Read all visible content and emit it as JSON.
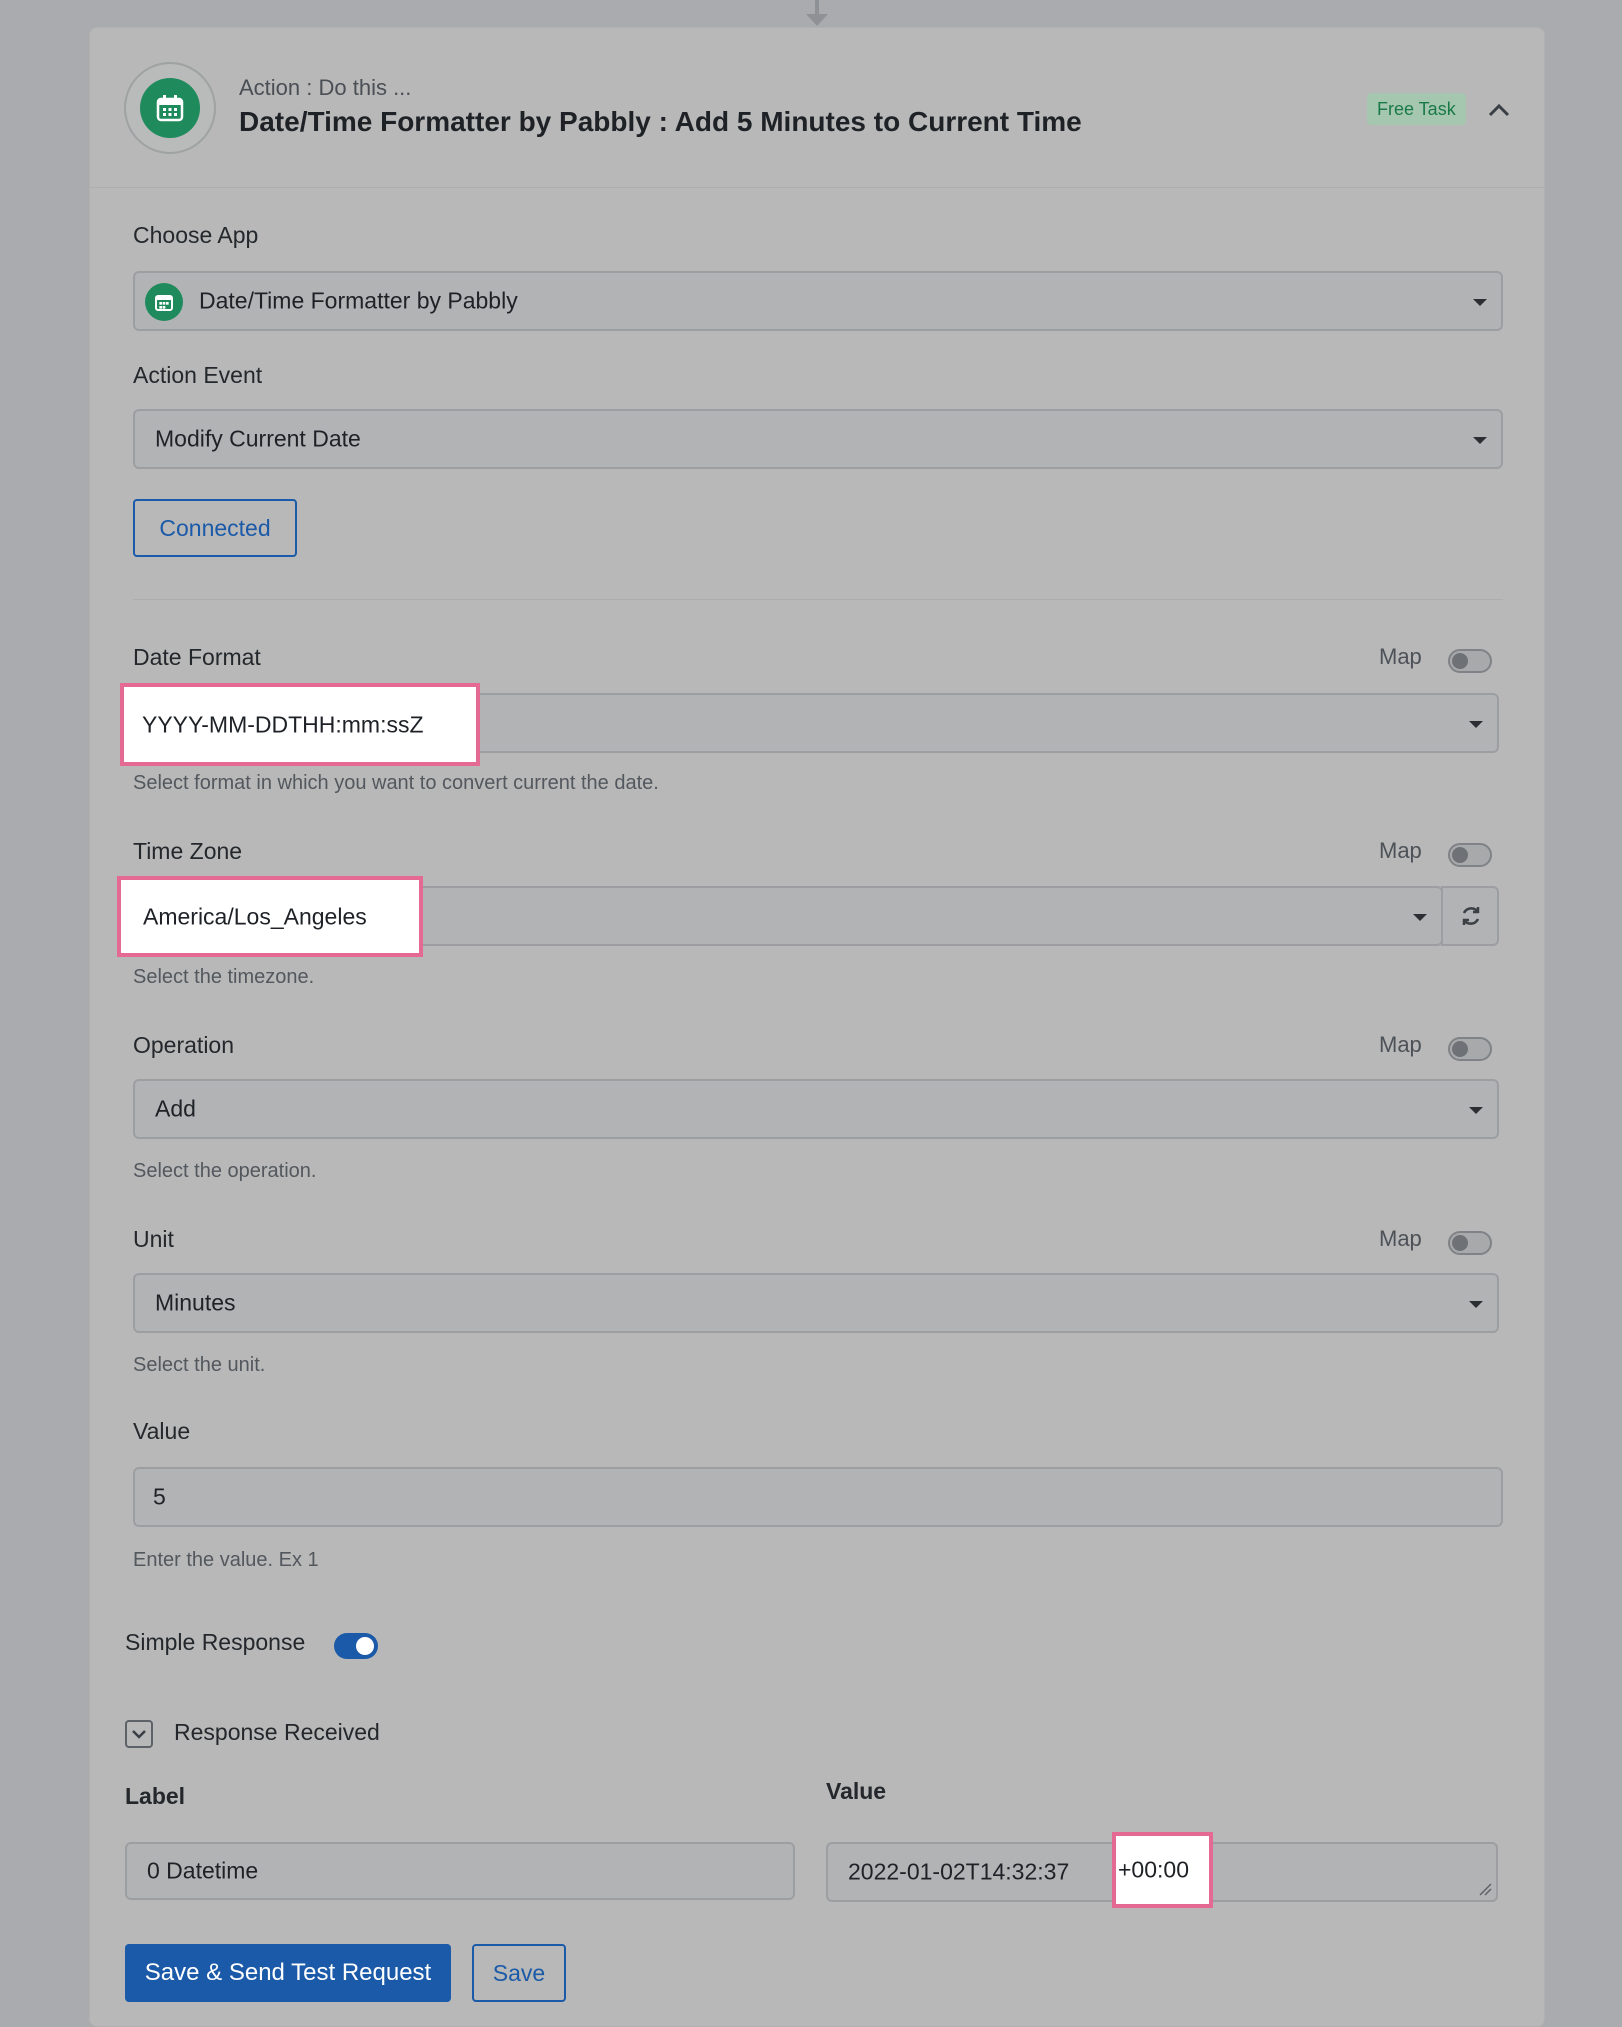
{
  "header": {
    "subtitle": "Action : Do this ...",
    "title": "Date/Time Formatter by Pabbly : Add 5 Minutes to Current Time",
    "badge": "Free Task"
  },
  "choose_app": {
    "label": "Choose App",
    "value": "Date/Time Formatter by Pabbly"
  },
  "action_event": {
    "label": "Action Event",
    "value": "Modify Current Date"
  },
  "connection_button": "Connected",
  "date_format": {
    "label": "Date Format",
    "map_label": "Map",
    "value": "YYYY-MM-DDTHH:mm:ssZ",
    "helper": "Select format in which you want to convert current the date."
  },
  "time_zone": {
    "label": "Time Zone",
    "map_label": "Map",
    "value": "America/Los_Angeles",
    "helper": "Select the timezone."
  },
  "operation": {
    "label": "Operation",
    "map_label": "Map",
    "value": "Add",
    "helper": "Select the operation."
  },
  "unit": {
    "label": "Unit",
    "map_label": "Map",
    "value": "Minutes",
    "helper": "Select the unit."
  },
  "value_field": {
    "label": "Value",
    "value": "5",
    "helper": "Enter the value. Ex 1"
  },
  "simple_response": {
    "label": "Simple Response",
    "enabled": true
  },
  "response": {
    "title": "Response Received",
    "label_header": "Label",
    "value_header": "Value",
    "label_value": "0 Datetime",
    "value_prefix": "2022-01-02T14:32:37",
    "value_suffix": "+00:00"
  },
  "buttons": {
    "save_send": "Save & Send Test Request",
    "save": "Save"
  },
  "colors": {
    "accent": "#1b5aa8",
    "brand_green": "#1f8a5c",
    "highlight": "#e56a93"
  }
}
